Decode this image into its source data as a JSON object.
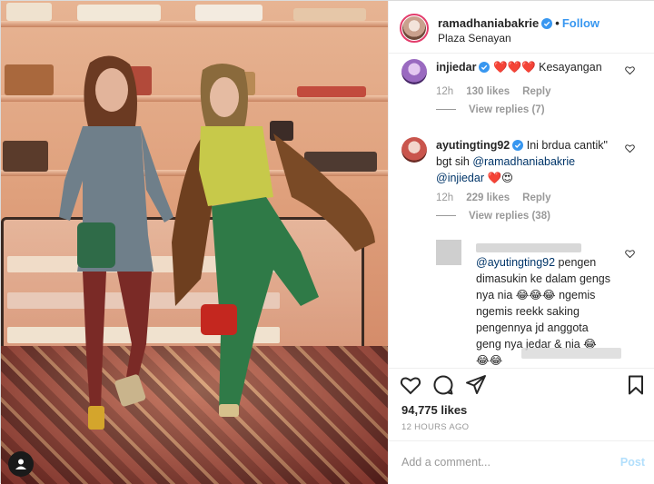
{
  "post": {
    "username": "ramadhaniabakrie",
    "follow_label": "Follow",
    "separator": "•",
    "location": "Plaza Senayan",
    "likes": "94,775 likes",
    "time": "12 HOURS AGO"
  },
  "comments": [
    {
      "username": "injiedar",
      "text": "Kesayangan",
      "emoji": "❤️❤️❤️",
      "age": "12h",
      "likes": "130 likes",
      "reply_label": "Reply",
      "view_replies": "View replies (7)"
    },
    {
      "username": "ayutingting92",
      "text_1": "Ini brdua cantik\"",
      "text_2": "bgt sih",
      "mention_1": "@ramadhaniabakrie",
      "mention_2": "@injiedar",
      "emoji": "❤️😍",
      "age": "12h",
      "likes": "229 likes",
      "reply_label": "Reply",
      "view_replies": "View replies (38)"
    },
    {
      "mention": "@ayutingting92",
      "line_1": "pengen",
      "line_2": "dimasukin ke dalam gengs",
      "line_3a": "nya nia",
      "line_3b": "ngemis",
      "line_4": "ngemis reekk saking",
      "line_5": "pengennya jd anggota",
      "line_6": "geng nya jedar & nia"
    }
  ],
  "emojis": {
    "laugh": "😂",
    "heart": "❤️",
    "heart_eyes": "😍"
  },
  "add_comment": {
    "placeholder": "Add a comment...",
    "post_label": "Post"
  },
  "colors": {
    "follow": "#3897f0",
    "verified": "#3897f0",
    "heart_red": "#ed4956",
    "post_disabled": "#b2dffc"
  }
}
